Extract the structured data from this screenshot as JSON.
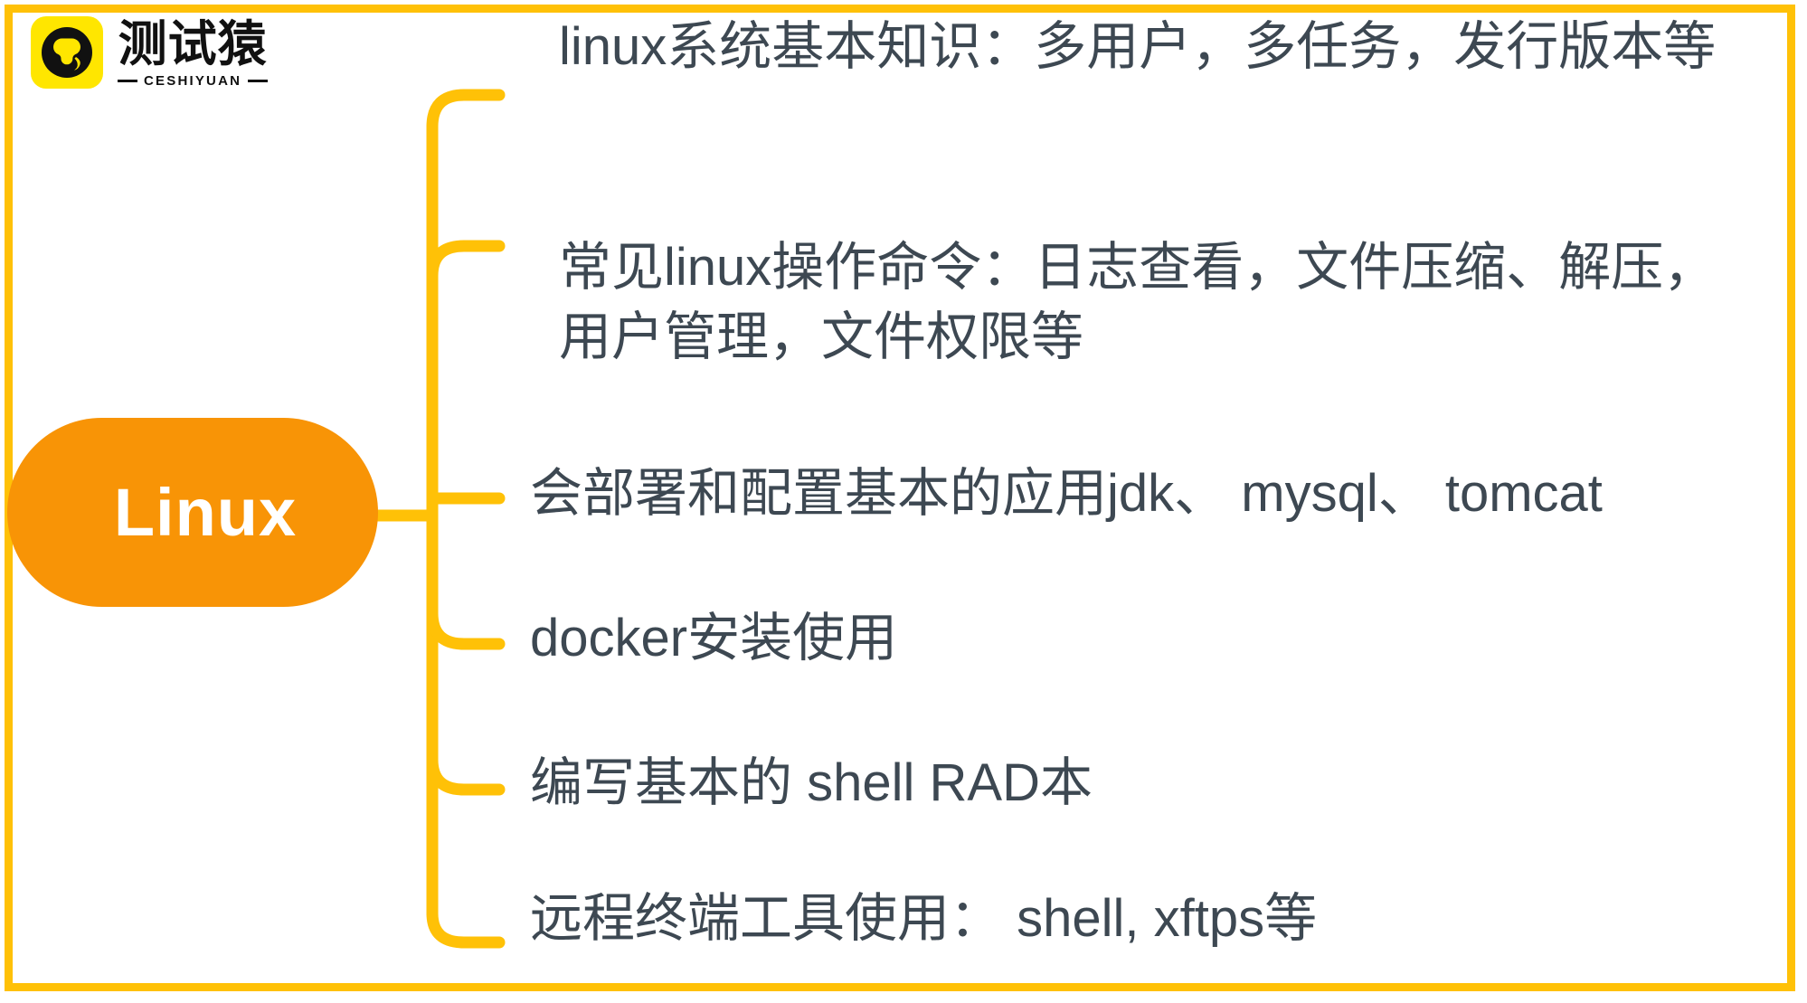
{
  "brand": {
    "name_cn": "测试猿",
    "name_en": "CESHIYUAN",
    "logo_icon": "monkey-face-icon",
    "logo_bg_color": "#ffe600"
  },
  "theme": {
    "frame_color": "#ffc107",
    "connector_color": "#ffc107",
    "root_node_color": "#f89406",
    "root_text_color": "#ffffff",
    "branch_text_color": "#3d4852",
    "background": "#ffffff"
  },
  "mindmap": {
    "type": "mindmap",
    "root": {
      "label": "Linux",
      "shape": "pill"
    },
    "branches": [
      {
        "id": 1,
        "text": "linux系统基本知识：多用户，多任务，发行版本等"
      },
      {
        "id": 2,
        "text": "常见linux操作命令：日志查看，文件压缩、解压，用户管理，文件权限等"
      },
      {
        "id": 3,
        "text": "会部署和配置基本的应用jdk、 mysql、 tomcat"
      },
      {
        "id": 4,
        "text": "docker安装使用"
      },
      {
        "id": 5,
        "text": "编写基本的 shell RAD本"
      },
      {
        "id": 6,
        "text": "远程终端工具使用： shell, xftps等"
      }
    ]
  }
}
